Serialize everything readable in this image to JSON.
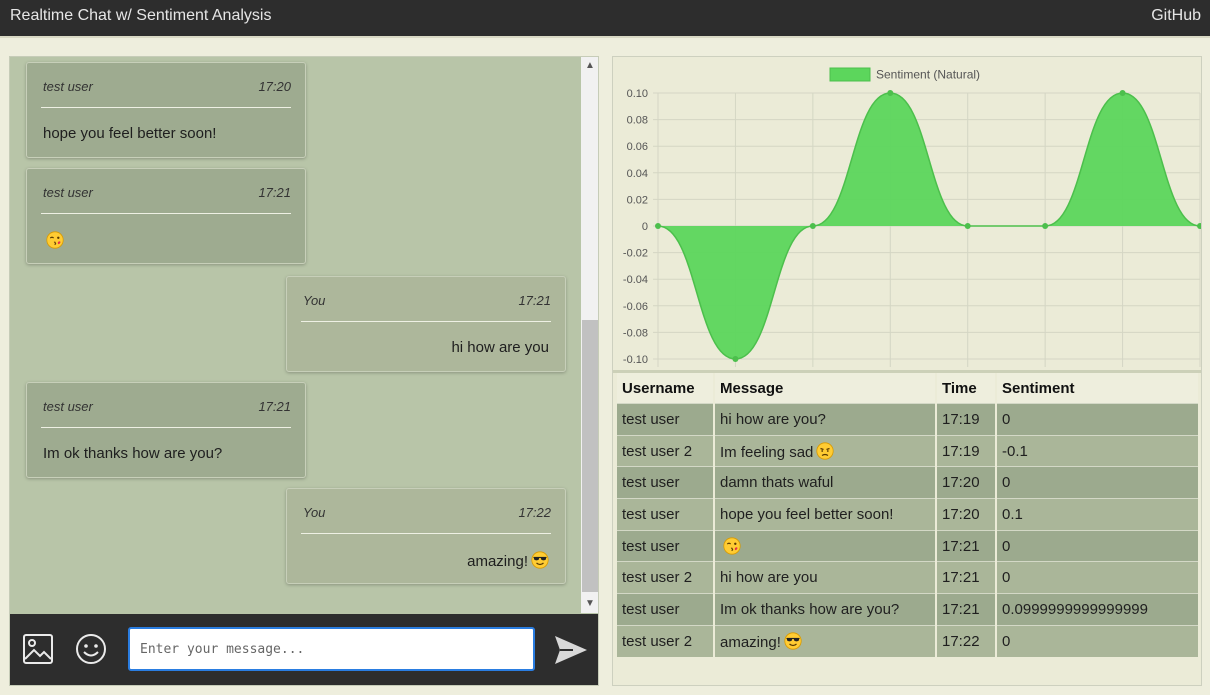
{
  "header": {
    "title": "Realtime Chat w/ Sentiment Analysis",
    "github_label": "GitHub"
  },
  "chat": {
    "messages": [
      {
        "user": "test user",
        "time": "17:20",
        "text": "hope you feel better soon!",
        "mine": false
      },
      {
        "user": "test user",
        "time": "17:21",
        "text": "",
        "emoji": "kissing-wink-emoji",
        "mine": false
      },
      {
        "user": "You",
        "time": "17:21",
        "text": "hi how are you",
        "mine": true
      },
      {
        "user": "test user",
        "time": "17:21",
        "text": "Im ok thanks how are you?",
        "mine": false
      },
      {
        "user": "You",
        "time": "17:22",
        "text": "amazing!",
        "emoji": "sunglasses-emoji",
        "mine": true
      }
    ],
    "input_placeholder": "Enter your message...",
    "icons": {
      "image": "image-icon",
      "emoji": "smiley-icon",
      "send": "send-icon"
    }
  },
  "chart_data": {
    "type": "area",
    "legend": [
      "Sentiment (Natural)"
    ],
    "legend_position": "top",
    "series": [
      {
        "name": "Sentiment (Natural)",
        "values": [
          0,
          -0.1,
          0,
          0.1,
          0,
          0,
          0.1,
          0
        ],
        "color": "#5cd65c"
      }
    ],
    "x_labels": [
      "",
      "",
      "",
      "",
      "",
      "",
      "",
      ""
    ],
    "ylim": [
      -0.1,
      0.1
    ],
    "y_ticks": [
      "0.10",
      "0.08",
      "0.06",
      "0.04",
      "0.02",
      "0",
      "-0.02",
      "-0.04",
      "-0.06",
      "-0.08",
      "-0.10"
    ],
    "grid": true,
    "interpolation": "smooth"
  },
  "table": {
    "headers": [
      "Username",
      "Message",
      "Time",
      "Sentiment"
    ],
    "rows": [
      {
        "username": "test user",
        "message": "hi how are you?",
        "time": "17:19",
        "sentiment": "0"
      },
      {
        "username": "test user 2",
        "message": "Im feeling sad",
        "emoji": "sad-face-emoji",
        "time": "17:19",
        "sentiment": "-0.1"
      },
      {
        "username": "test user",
        "message": "damn thats waful",
        "time": "17:20",
        "sentiment": "0"
      },
      {
        "username": "test user",
        "message": "hope you feel better soon!",
        "time": "17:20",
        "sentiment": "0.1"
      },
      {
        "username": "test user",
        "message": "",
        "emoji": "kissing-wink-emoji",
        "time": "17:21",
        "sentiment": "0"
      },
      {
        "username": "test user 2",
        "message": "hi how are you",
        "time": "17:21",
        "sentiment": "0"
      },
      {
        "username": "test user",
        "message": "Im ok thanks how are you?",
        "time": "17:21",
        "sentiment": "0.0999999999999999"
      },
      {
        "username": "test user 2",
        "message": "amazing!",
        "emoji": "sunglasses-emoji",
        "time": "17:22",
        "sentiment": "0"
      }
    ]
  },
  "colors": {
    "topbar": "#2d2d2d",
    "chat_bg": "#b8c5a8",
    "bubble": "#9eab90",
    "accent_green": "#5cd65c",
    "input_focus": "#2a7de1"
  }
}
